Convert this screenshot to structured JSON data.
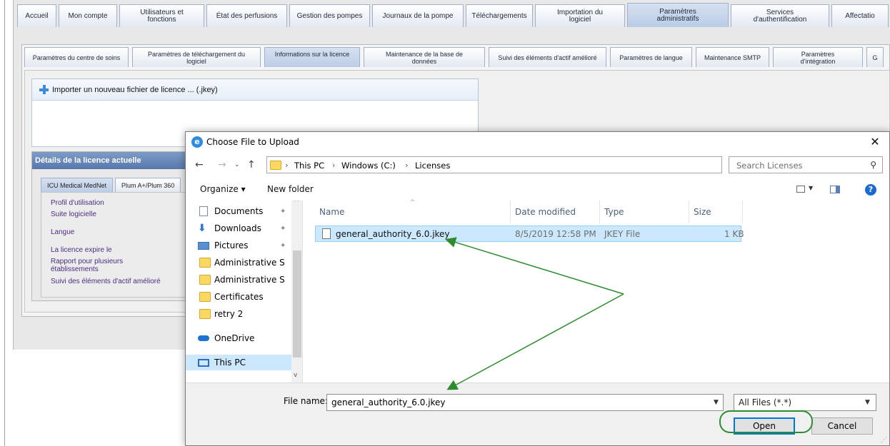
{
  "app": {
    "main_tabs": [
      {
        "label": "Accueil"
      },
      {
        "label": "Mon compte"
      },
      {
        "label": "Utilisateurs et\nfonctions"
      },
      {
        "label": "État des perfusions"
      },
      {
        "label": "Gestion des pompes"
      },
      {
        "label": "Journaux de la pompe"
      },
      {
        "label": "Téléchargements"
      },
      {
        "label": "Importation du\nlogiciel"
      },
      {
        "label": "Paramètres\nadministratifs",
        "active": true
      },
      {
        "label": "Services\nd'authentification"
      },
      {
        "label": "Affectatio"
      }
    ],
    "sub_tabs": [
      {
        "label": "Paramètres du centre de soins"
      },
      {
        "label": "Paramètres de téléchargement du\nlogiciel"
      },
      {
        "label": "Informations sur la licence",
        "active": true
      },
      {
        "label": "Maintenance de la base de\ndonnées"
      },
      {
        "label": "Suivi des éléments d'actif amélioré"
      },
      {
        "label": "Paramètres de langue"
      },
      {
        "label": "Maintenance SMTP"
      },
      {
        "label": "Paramètres\nd'intégration"
      },
      {
        "label": "G"
      }
    ],
    "import_label": "Importer un nouveau fichier de licence ... (.jkey)",
    "license": {
      "header": "Détails de la licence actuelle",
      "tabs": [
        "ICU Medical MedNet",
        "Plum A+/Plum 360"
      ],
      "fields": [
        "Profil d'utilisation",
        "Suite logicielle",
        "Langue",
        "La licence expire le",
        "Rapport pour plusieurs\nétablissements",
        "Suivi des éléments d'actif amélioré"
      ]
    }
  },
  "dialog": {
    "title": "Choose File to Upload",
    "breadcrumb": [
      "This PC",
      "Windows (C:)",
      "Licenses"
    ],
    "search_placeholder": "Search Licenses",
    "toolbar": {
      "organize": "Organize ▾",
      "new_folder": "New folder"
    },
    "nav_items": [
      {
        "label": "Documents",
        "icon": "documents-icon",
        "pinned": true
      },
      {
        "label": "Downloads",
        "icon": "downloads-icon",
        "pinned": true
      },
      {
        "label": "Pictures",
        "icon": "pictures-icon",
        "pinned": true
      },
      {
        "label": "Administrative S",
        "icon": "folder-icon"
      },
      {
        "label": "Administrative S",
        "icon": "folder-icon"
      },
      {
        "label": "Certificates",
        "icon": "folder-icon"
      },
      {
        "label": "retry 2",
        "icon": "folder-icon"
      },
      {
        "label": "OneDrive",
        "icon": "onedrive-icon"
      },
      {
        "label": "This PC",
        "icon": "computer-icon",
        "selected": true
      }
    ],
    "columns": [
      "Name",
      "Date modified",
      "Type",
      "Size"
    ],
    "files": [
      {
        "name": "general_authority_6.0.jkey",
        "date": "8/5/2019 12:58 PM",
        "type": "JKEY File",
        "size": "1 KB"
      }
    ],
    "file_name_label": "File name:",
    "file_name_value": "general_authority_6.0.jkey",
    "filter": "All Files (*.*)",
    "open_label": "Open",
    "cancel_label": "Cancel"
  },
  "colors": {
    "annotation_green": "#2e8b2e",
    "selection_blue": "#cce8ff",
    "accent_blue": "#0078d7",
    "license_header": "#5f7fb3",
    "license_field_text": "#4b2d83"
  }
}
